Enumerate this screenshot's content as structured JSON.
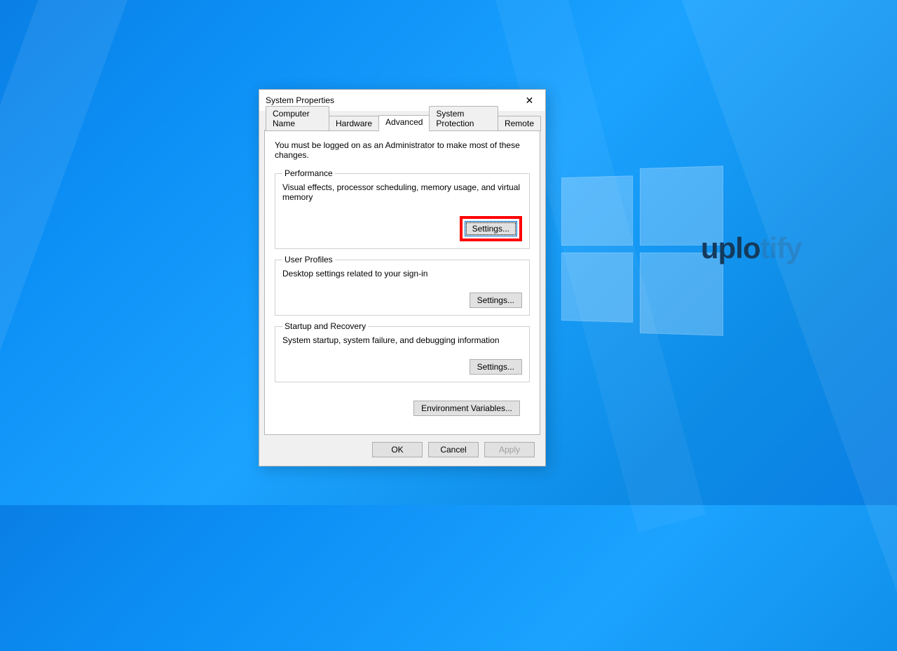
{
  "window": {
    "title": "System Properties"
  },
  "tabs": {
    "computer_name": "Computer Name",
    "hardware": "Hardware",
    "advanced": "Advanced",
    "system_protection": "System Protection",
    "remote": "Remote"
  },
  "advanced_tab": {
    "admin_note": "You must be logged on as an Administrator to make most of these changes.",
    "performance": {
      "legend": "Performance",
      "desc": "Visual effects, processor scheduling, memory usage, and virtual memory",
      "button": "Settings..."
    },
    "user_profiles": {
      "legend": "User Profiles",
      "desc": "Desktop settings related to your sign-in",
      "button": "Settings..."
    },
    "startup": {
      "legend": "Startup and Recovery",
      "desc": "System startup, system failure, and debugging information",
      "button": "Settings..."
    },
    "env_button": "Environment Variables..."
  },
  "dialog_buttons": {
    "ok": "OK",
    "cancel": "Cancel",
    "apply": "Apply"
  },
  "watermark": {
    "bold": "uplo",
    "faded": "tify"
  }
}
